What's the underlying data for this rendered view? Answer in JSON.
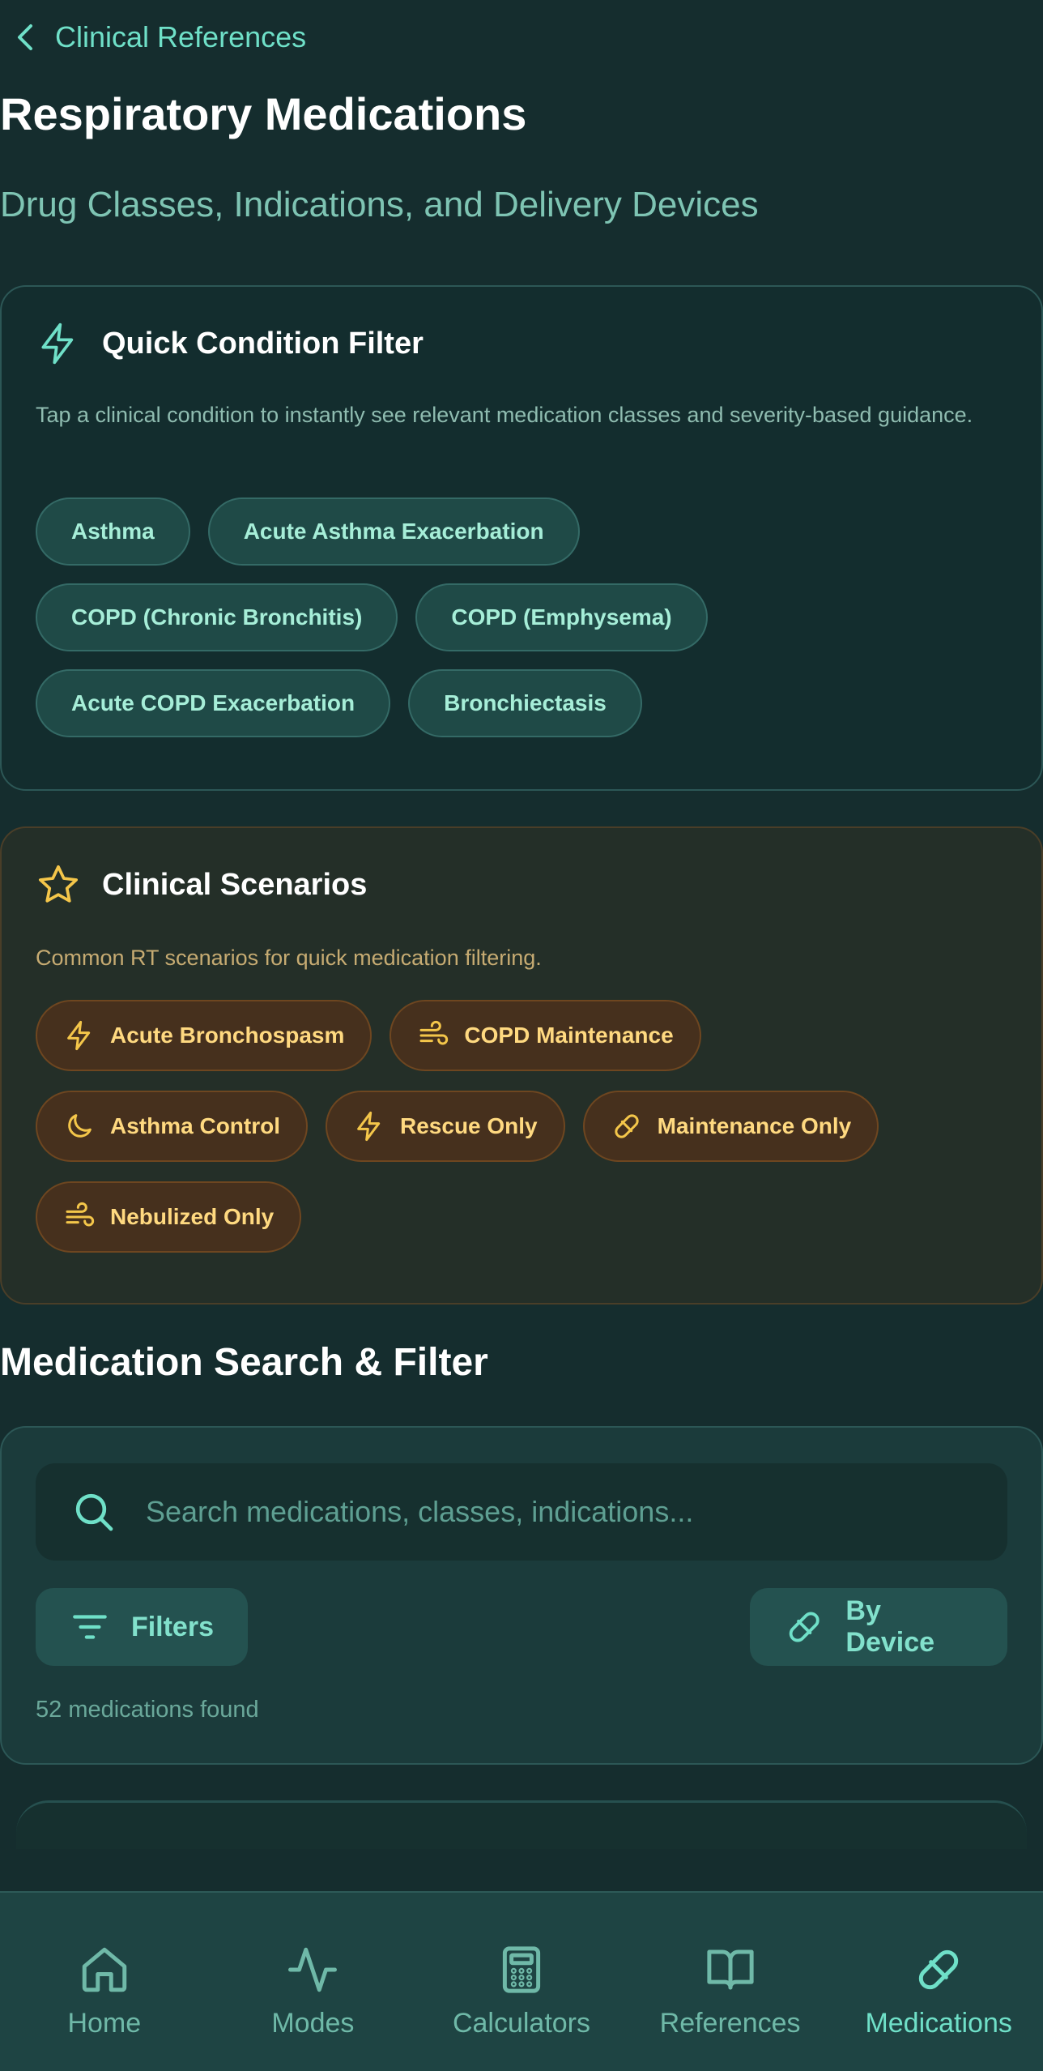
{
  "header": {
    "back_label": "Clinical References",
    "title": "Respiratory Medications",
    "subtitle": "Drug Classes, Indications, and Delivery Devices"
  },
  "condition_filter": {
    "title": "Quick Condition Filter",
    "description": "Tap a clinical condition to instantly see relevant medication classes and severity-based guidance.",
    "chips": [
      "Asthma",
      "Acute Asthma Exacerbation",
      "COPD (Chronic Bronchitis)",
      "COPD (Emphysema)",
      "Acute COPD Exacerbation",
      "Bronchiectasis"
    ]
  },
  "scenarios": {
    "title": "Clinical Scenarios",
    "description": "Common RT scenarios for quick medication filtering.",
    "chips": [
      {
        "label": "Acute Bronchospasm",
        "icon": "lightning-icon"
      },
      {
        "label": "COPD Maintenance",
        "icon": "wind-icon"
      },
      {
        "label": "Asthma Control",
        "icon": "moon-icon"
      },
      {
        "label": "Rescue Only",
        "icon": "lightning-icon"
      },
      {
        "label": "Maintenance Only",
        "icon": "pill-icon"
      },
      {
        "label": "Nebulized Only",
        "icon": "wind-icon"
      }
    ]
  },
  "search": {
    "section_title": "Medication Search & Filter",
    "placeholder": "Search medications, classes, indications...",
    "filters_label": "Filters",
    "device_label": "By Device",
    "result_count": "52 medications found"
  },
  "nav": {
    "items": [
      {
        "label": "Home",
        "icon": "home-icon"
      },
      {
        "label": "Modes",
        "icon": "activity-icon"
      },
      {
        "label": "Calculators",
        "icon": "calculator-icon"
      },
      {
        "label": "References",
        "icon": "book-icon"
      },
      {
        "label": "Medications",
        "icon": "pill-icon",
        "active": true
      }
    ]
  },
  "colors": {
    "background": "#152d2e",
    "accent_teal": "#6fe0c8",
    "accent_amber": "#ffd980"
  }
}
